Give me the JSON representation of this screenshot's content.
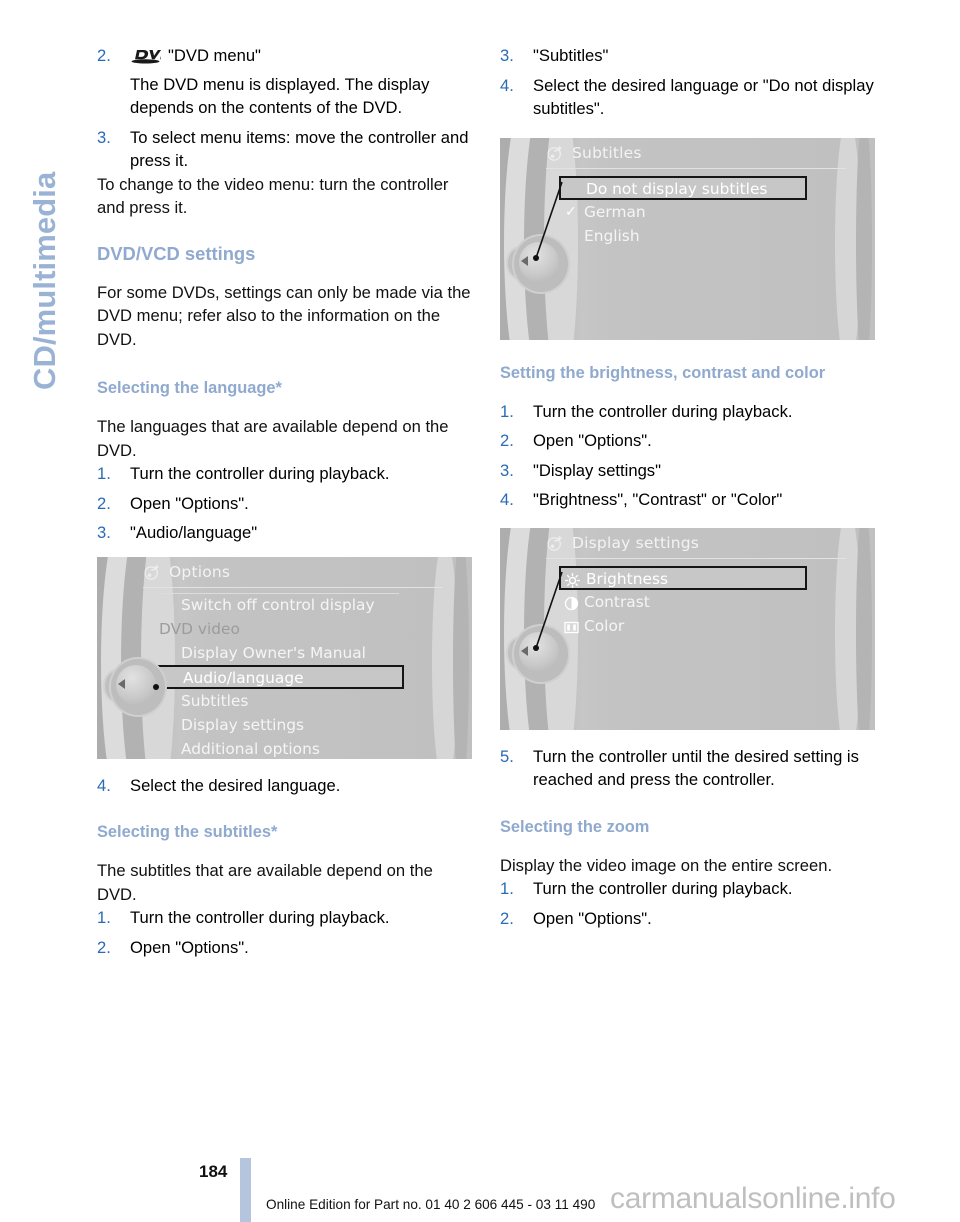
{
  "side_tab": {
    "label": "CD/multimedia"
  },
  "colors": {
    "heading_blue": "#8fa9cf",
    "list_number_blue": "#2a6bb5",
    "footer_bar_blue": "#b5c5de",
    "watermark_gray": "#bfbfbf"
  },
  "left_column": {
    "step_2_label": "2.",
    "step_2_icon": "dvd-logo-icon",
    "step_2_text": "\"DVD menu\"",
    "step_2_detail": "The DVD menu is displayed. The display depends on the contents of the DVD.",
    "step_3_label": "3.",
    "step_3_text": "To select menu items: move the controller and press it.",
    "paragraph_video_menu": "To change to the video menu: turn the controller and press it.",
    "heading_dvd_vcd": "DVD/VCD settings",
    "paragraph_dvd_vcd": "For some DVDs, settings can only be made via the DVD menu; refer also to the information on the DVD.",
    "subheading_language": "Selecting the language*",
    "paragraph_language": "The languages that are available depend on the DVD.",
    "language_steps": [
      {
        "num": "1.",
        "text": "Turn the controller during playback."
      },
      {
        "num": "2.",
        "text": "Open \"Options\"."
      },
      {
        "num": "3.",
        "text": "\"Audio/language\""
      }
    ],
    "step_4_label": "4.",
    "step_4_text": "Select the desired language.",
    "subheading_subtitles": "Selecting the subtitles*",
    "paragraph_subtitles": "The subtitles that are available depend on the DVD.",
    "subtitle_steps": [
      {
        "num": "1.",
        "text": "Turn the controller during playback."
      },
      {
        "num": "2.",
        "text": "Open \"Options\"."
      }
    ]
  },
  "right_column": {
    "subtitle_steps_cont": [
      {
        "num": "3.",
        "text": "\"Subtitles\""
      },
      {
        "num": "4.",
        "text": "Select the desired language or \"Do not display subtitles\"."
      }
    ],
    "heading_brightness": "Setting the brightness, contrast and color",
    "brightness_steps": [
      {
        "num": "1.",
        "text": "Turn the controller during playback."
      },
      {
        "num": "2.",
        "text": "Open \"Options\"."
      },
      {
        "num": "3.",
        "text": "\"Display settings\""
      },
      {
        "num": "4.",
        "text": "\"Brightness\", \"Contrast\" or \"Color\""
      }
    ],
    "step_5_label": "5.",
    "step_5_text": "Turn the controller until the desired setting is reached and press the controller.",
    "heading_zoom": "Selecting the zoom",
    "paragraph_zoom": "Display the video image on the entire screen.",
    "zoom_steps": [
      {
        "num": "1.",
        "text": "Turn the controller during playback."
      },
      {
        "num": "2.",
        "text": "Open \"Options\"."
      }
    ]
  },
  "screenshot_options": {
    "title": "Options",
    "header_icon": "cd-options-icon",
    "rows": [
      {
        "text": "Switch off control display",
        "state": "normal",
        "rule_top": true
      },
      {
        "text": "DVD video",
        "state": "dim"
      },
      {
        "text": "Display Owner's Manual",
        "state": "normal"
      },
      {
        "text": "Audio/language",
        "state": "highlight"
      },
      {
        "text": "Subtitles",
        "state": "normal"
      },
      {
        "text": "Display settings",
        "state": "normal"
      },
      {
        "text": "Additional options",
        "state": "normal"
      }
    ]
  },
  "screenshot_subtitles": {
    "title": "Subtitles",
    "header_icon": "cd-options-icon",
    "rows": [
      {
        "text": "Do not display subtitles",
        "state": "highlight"
      },
      {
        "text": "German",
        "state": "normal",
        "check": "✓"
      },
      {
        "text": "English",
        "state": "normal"
      }
    ]
  },
  "screenshot_display_settings": {
    "title": "Display settings",
    "header_icon": "cd-options-icon",
    "rows": [
      {
        "text": "Brightness",
        "state": "highlight",
        "icon": "sun-icon"
      },
      {
        "text": "Contrast",
        "state": "normal",
        "icon": "contrast-icon"
      },
      {
        "text": "Color",
        "state": "normal",
        "icon": "color-icon"
      }
    ]
  },
  "footer": {
    "page_number": "184",
    "edition_text": "Online Edition for Part no. 01 40 2 606 445 - 03 11 490",
    "watermark": "carmanualsonline.info"
  }
}
